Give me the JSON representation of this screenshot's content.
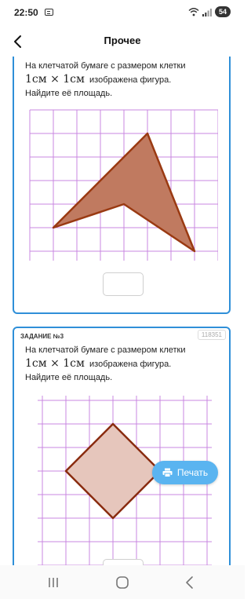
{
  "status": {
    "time": "22:50",
    "battery": "54"
  },
  "appbar": {
    "title": "Прочее"
  },
  "cards": [
    {
      "label": "",
      "id": "",
      "text_before": "На клетчатой бумаге с размером клетки",
      "unit_expr": "1см × 1см",
      "text_after": "изображена фигура.",
      "question": "Найдите её площадь."
    },
    {
      "label": "ЗАДАНИЕ №3",
      "id": "118351",
      "text_before": "На клетчатой бумаге с размером клетки",
      "unit_expr": "1см × 1см",
      "text_after": "изображена фигура.",
      "question": "Найдите её площадь."
    }
  ],
  "print_button": {
    "label": "Печать"
  },
  "icons": {
    "back": "back-arrow-icon",
    "print": "printer-icon",
    "nav_recents": "recents-icon",
    "nav_home": "home-icon",
    "nav_back": "nav-back-icon"
  },
  "colors": {
    "accent": "#2f8fd8",
    "print_button": "#5ab4f0",
    "grid": "#c987e0",
    "figure1_fill": "#c07a60",
    "figure1_stroke": "#9a3a12",
    "figure2_fill": "#e6c6bc",
    "figure2_stroke": "#8a2c10"
  }
}
